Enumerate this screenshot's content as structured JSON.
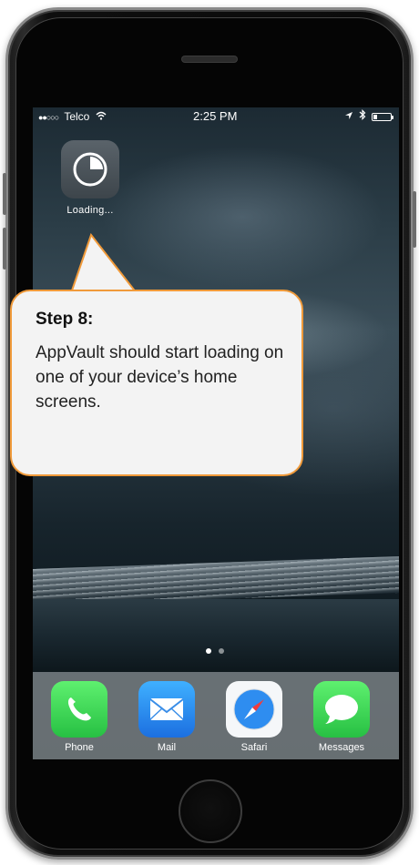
{
  "status_bar": {
    "carrier": "Telco",
    "time": "2:25  PM"
  },
  "app": {
    "label": "Loading...",
    "icon": "loading-pie-icon"
  },
  "callout": {
    "title": "Step 8:",
    "body": "AppVault should start loading on one of your device’s home screens."
  },
  "dock": {
    "items": [
      {
        "label": "Phone",
        "icon": "phone-icon",
        "color": "#3ddc5a"
      },
      {
        "label": "Mail",
        "icon": "mail-icon",
        "color": "#2f8ff0"
      },
      {
        "label": "Safari",
        "icon": "safari-icon",
        "color": "#f4f6f8"
      },
      {
        "label": "Messages",
        "icon": "messages-icon",
        "color": "#37d150"
      }
    ]
  },
  "colors": {
    "callout_border": "#f09a3a",
    "callout_bg": "#f3f3f3"
  }
}
